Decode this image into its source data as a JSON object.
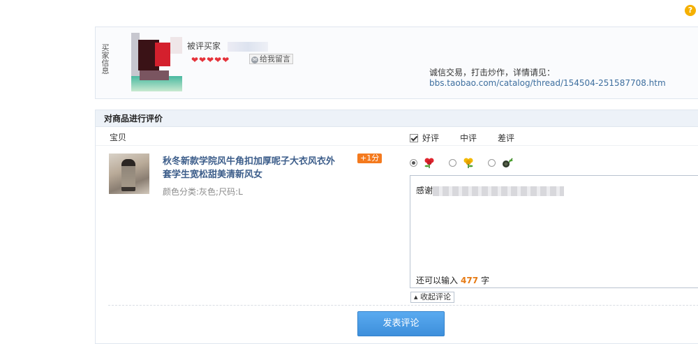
{
  "help": {
    "label": "?"
  },
  "seller": {
    "side_label": "买家信息",
    "name_label": "被评买家",
    "hearts": "❤❤❤❤❤",
    "message_button": "给我留言",
    "notice": "诚信交易，打击炒作，详情请见：",
    "notice_link": "bbs.taobao.com/catalog/thread/154504-251587708.htm"
  },
  "review": {
    "header": "对商品进行评价",
    "col_item": "宝贝",
    "ratings": {
      "good": "好评",
      "neutral": "中评",
      "bad": "差评"
    },
    "selected_rating": "good",
    "product": {
      "title": "秋冬新款学院风牛角扣加厚呢子大衣风衣外套学生宽松甜美清新风女",
      "sku": "颜色分类:灰色;尺码:L",
      "bonus_badge": "+1分"
    },
    "comment": {
      "text_prefix": "感谢",
      "remaining_label": "还可以输入",
      "remaining_count": "477",
      "remaining_unit": "字"
    },
    "collapse_button": "收起评论",
    "submit_button": "发表评论"
  }
}
